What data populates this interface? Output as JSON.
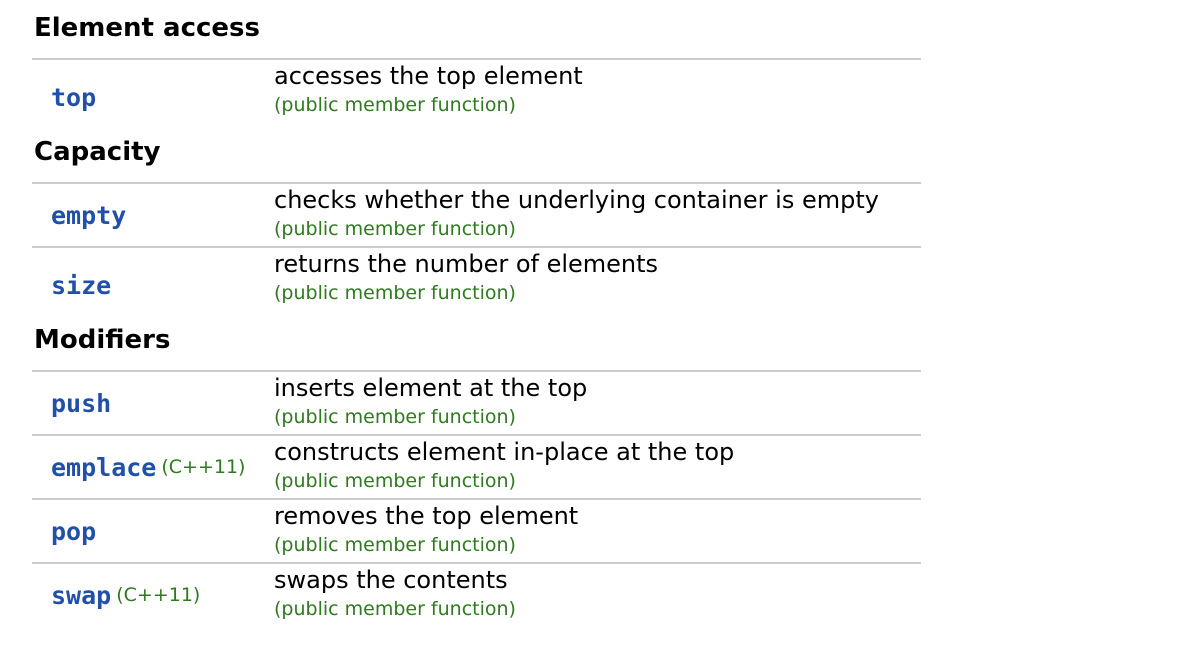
{
  "sections": [
    {
      "heading": "Element access",
      "rows": [
        {
          "name": "top",
          "tag": "",
          "desc": "accesses the top element",
          "kind": "(public member function)"
        }
      ]
    },
    {
      "heading": "Capacity",
      "rows": [
        {
          "name": "empty",
          "tag": "",
          "desc": "checks whether the underlying container is empty",
          "kind": "(public member function)"
        },
        {
          "name": "size",
          "tag": "",
          "desc": "returns the number of elements",
          "kind": "(public member function)"
        }
      ]
    },
    {
      "heading": "Modifiers",
      "rows": [
        {
          "name": "push",
          "tag": "",
          "desc": "inserts element at the top",
          "kind": "(public member function)"
        },
        {
          "name": "emplace",
          "tag": "(C++11)",
          "desc": "constructs element in-place at the top",
          "kind": "(public member function)"
        },
        {
          "name": "pop",
          "tag": "",
          "desc": "removes the top element",
          "kind": "(public member function)"
        },
        {
          "name": "swap",
          "tag": "(C++11)",
          "desc": "swaps the contents",
          "kind": "(public member function)"
        }
      ]
    }
  ]
}
